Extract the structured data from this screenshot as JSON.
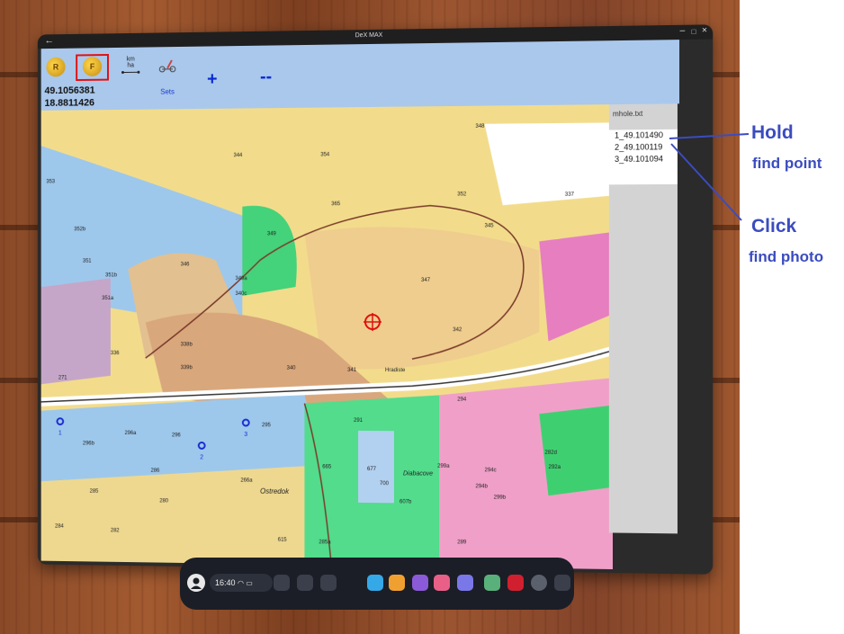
{
  "window": {
    "title": "DeX MAX",
    "back_glyph": "←",
    "minimize_glyph": "–",
    "maximize_glyph": "□",
    "close_glyph": "×"
  },
  "toolbar": {
    "btn_r": "R",
    "btn_f": "F",
    "km_label": "km",
    "ha_label": "ha",
    "sets_label": "Sets",
    "plus_label": "+",
    "minus_label": "--",
    "lat": "49.1056381",
    "lon": "18.8811426"
  },
  "side_panel": {
    "file_name": "mhole.txt",
    "items": [
      "1_49.101490",
      "2_49.100119",
      "3_49.101094"
    ]
  },
  "annotations": {
    "hold": "Hold",
    "find_point": "find point",
    "click": "Click",
    "find_photo": "find photo",
    "color": "#3b4cc0"
  },
  "map": {
    "labels": [
      "354",
      "344",
      "365",
      "352",
      "348",
      "337",
      "353",
      "352b",
      "351",
      "351b",
      "351a",
      "349",
      "349a",
      "346",
      "340c",
      "347",
      "345",
      "342",
      "338b",
      "336",
      "339b",
      "340",
      "341",
      "Hradiste",
      "294",
      "296a",
      "296b",
      "296",
      "295",
      "291",
      "286",
      "280",
      "266a",
      "665",
      "677",
      "700",
      "299a",
      "299b",
      "607b",
      "Diabacove",
      "Ostredok",
      "284",
      "285",
      "282",
      "615",
      "285a",
      "289",
      "294b",
      "294c",
      "292a",
      "282d",
      "271"
    ],
    "point_markers": [
      "1",
      "2",
      "3"
    ]
  },
  "taskbar": {
    "time": "16:40"
  },
  "colors": {
    "toolbar": "#aac8ec",
    "marker": "#e01010",
    "point": "#1a2ad0"
  }
}
